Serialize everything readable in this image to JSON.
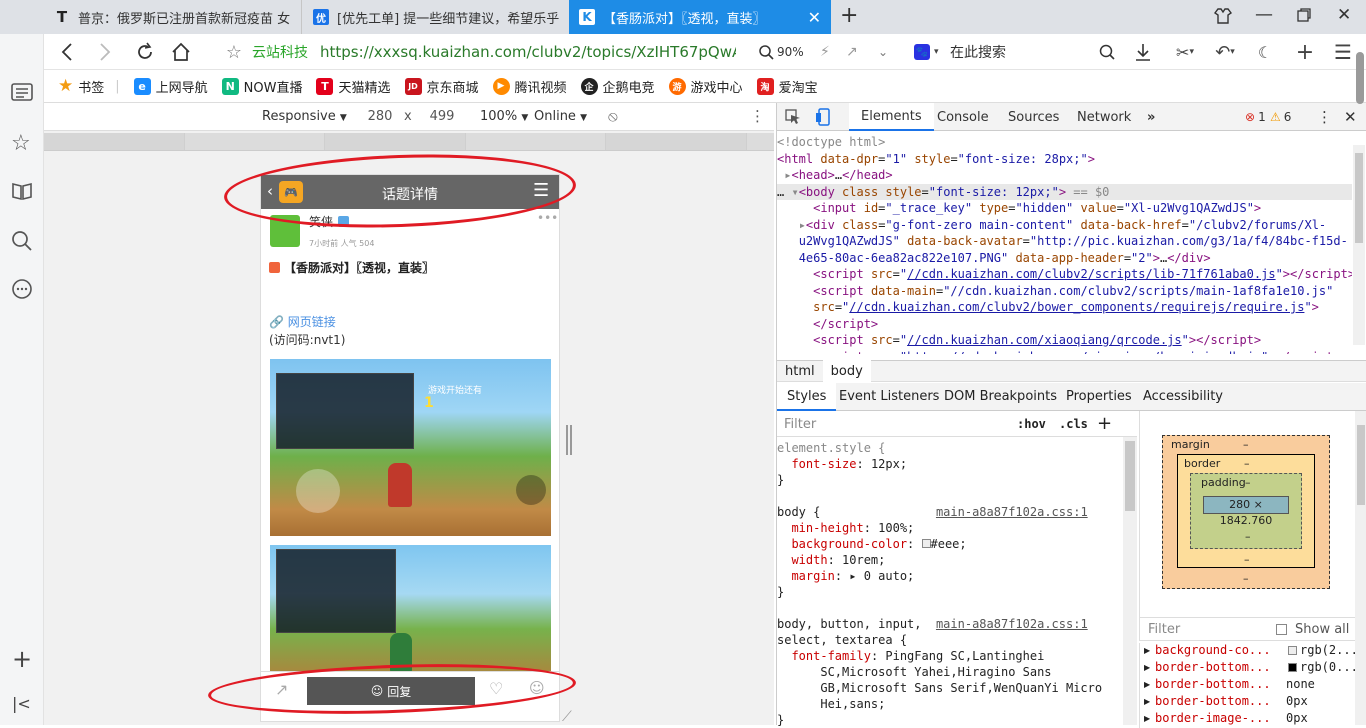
{
  "tabs": [
    {
      "icon": "T",
      "title": "普京：俄罗斯已注册首款新冠疫苗 女..."
    },
    {
      "icon": "优",
      "title": "[优先工单] 提一些细节建议，希望乐乎..."
    },
    {
      "icon": "K",
      "title": "【香肠派对】〖透视，直装〗",
      "close": "✕"
    }
  ],
  "new_tab": "+",
  "address": {
    "site_name": "云站科技",
    "url": "https://xxxsq.kuaizhan.com/clubv2/topics/XzIHT67pQwAa",
    "zoom": "90%",
    "search_placeholder": "在此搜索"
  },
  "bookmarks": [
    {
      "label": "书签",
      "color": "#f39c12",
      "icon": "★"
    },
    {
      "label": "上网导航",
      "color": "#1a8cff",
      "icon": "e"
    },
    {
      "label": "NOW直播",
      "color": "#10b981",
      "icon": "N"
    },
    {
      "label": "天猫精选",
      "color": "#e3001b",
      "icon": "T"
    },
    {
      "label": "京东商城",
      "color": "#c9151e",
      "icon": "JD"
    },
    {
      "label": "腾讯视频",
      "color": "#ff8a00",
      "icon": "▶"
    },
    {
      "label": "企鹅电竞",
      "color": "#222222",
      "icon": "企"
    },
    {
      "label": "游戏中心",
      "color": "#ff6a00",
      "icon": "游"
    },
    {
      "label": "爱淘宝",
      "color": "#e02020",
      "icon": "淘"
    }
  ],
  "responsive": {
    "mode": "Responsive",
    "width": "280",
    "x": "x",
    "height": "499",
    "zoom": "100%",
    "network": "Online"
  },
  "phone": {
    "header_title": "话题详情",
    "author": "笑侠",
    "meta": "7小时前  人气 504",
    "post_title": "【香肠派对】〖透视，直装〗",
    "link_label": "网页链接",
    "access_code": "(访问码:nvt1)",
    "game_notice": "游戏开始还有",
    "game_count": "1",
    "reply_label": "回复"
  },
  "devtools": {
    "tabs": [
      "Elements",
      "Console",
      "Sources",
      "Network"
    ],
    "errors": "1",
    "warnings": "6",
    "breadcrumb": [
      "html",
      "body"
    ],
    "subtabs": [
      "Styles",
      "Event Listeners",
      "DOM Breakpoints",
      "Properties",
      "Accessibility"
    ],
    "filter_placeholder": "Filter",
    "hov": ":hov",
    "cls": ".cls",
    "box": {
      "margin": "margin",
      "border": "border",
      "padding": "padding",
      "content": "280 × 1842.760",
      "dash": "–"
    },
    "computed_filter": "Filter",
    "show_all": "Show all",
    "computed": [
      {
        "prop": "background-co...",
        "val": "rgb(2...",
        "swatch": "#eeeeee"
      },
      {
        "prop": "border-bottom...",
        "val": "rgb(0...",
        "swatch": "#000000"
      },
      {
        "prop": "border-bottom...",
        "val": "none"
      },
      {
        "prop": "border-bottom...",
        "val": "0px"
      },
      {
        "prop": "border-image-...",
        "val": "0px"
      }
    ]
  }
}
